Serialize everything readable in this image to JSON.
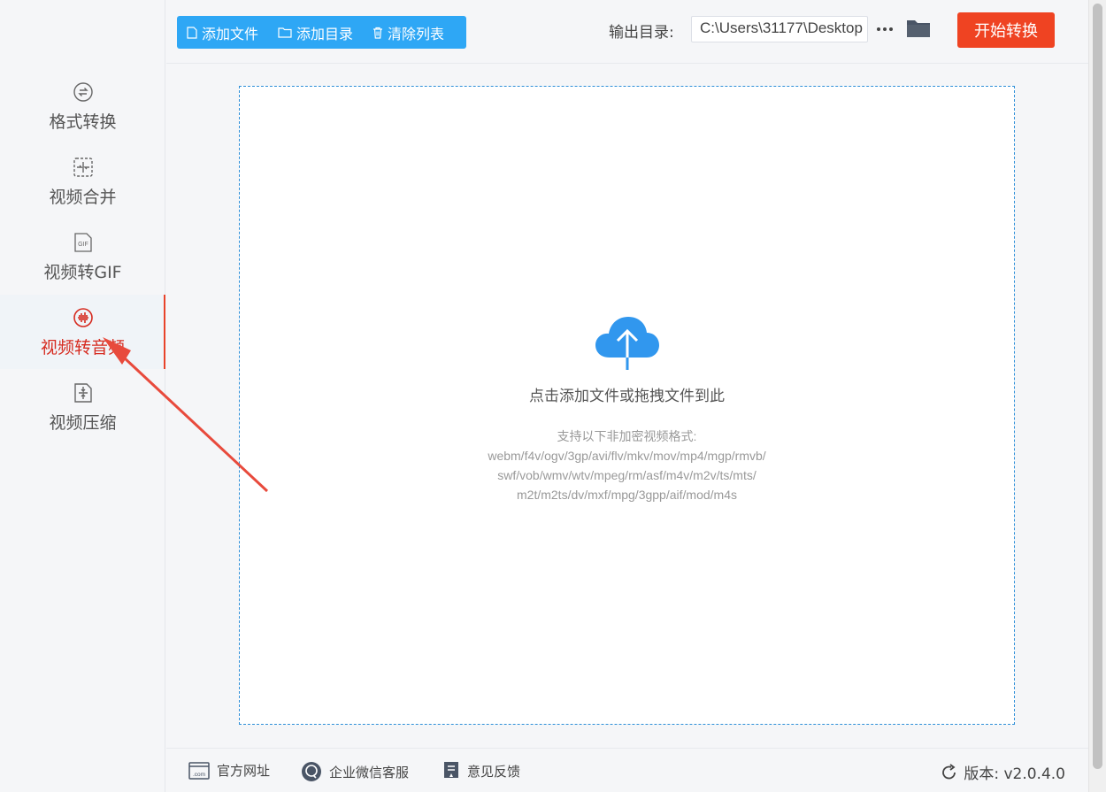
{
  "sidebar": {
    "items": [
      {
        "label": "格式转换",
        "icon": "format-convert-icon"
      },
      {
        "label": "视频合并",
        "icon": "video-merge-icon"
      },
      {
        "label": "视频转GIF",
        "icon": "gif-icon"
      },
      {
        "label": "视频转音频",
        "icon": "audio-wave-icon",
        "active": true
      },
      {
        "label": "视频压缩",
        "icon": "compress-icon"
      }
    ]
  },
  "toolbar": {
    "add_file": "添加文件",
    "add_dir": "添加目录",
    "clear_list": "清除列表",
    "output_label": "输出目录:",
    "output_path": "C:\\Users\\31177\\Desktop",
    "start": "开始转换"
  },
  "dropzone": {
    "title": "点击添加文件或拖拽文件到此",
    "formats_label": "支持以下非加密视频格式:",
    "formats_line1": "webm/f4v/ogv/3gp/avi/flv/mkv/mov/mp4/mgp/rmvb/",
    "formats_line2": "swf/vob/wmv/wtv/mpeg/rm/asf/m4v/m2v/ts/mts/",
    "formats_line3": "m2t/m2ts/dv/mxf/mpg/3gpp/aif/mod/m4s"
  },
  "footer": {
    "website": "官方网址",
    "wechat": "企业微信客服",
    "feedback": "意见反馈",
    "version": "版本: v2.0.4.0"
  },
  "colors": {
    "accent_blue": "#2ea7f5",
    "start_red": "#ef4322",
    "active_red": "#d62b20",
    "annotation_red": "#e84a3c"
  }
}
